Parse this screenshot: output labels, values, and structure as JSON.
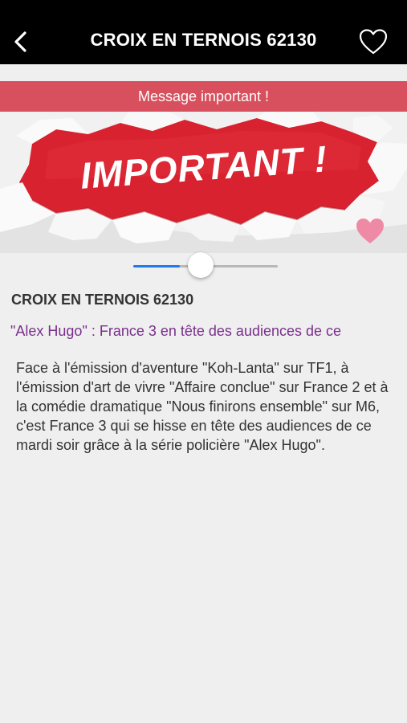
{
  "header": {
    "title": "CROIX EN TERNOIS 62130",
    "back_icon": "chevron-left-icon",
    "favorite_icon": "heart-outline-icon"
  },
  "banner": {
    "text": "Message important !",
    "color": "#d8505d"
  },
  "hero": {
    "headline": "IMPORTANT !",
    "accent_color": "#d8222f",
    "favorite_icon": "heart-filled-icon",
    "favorite_color": "#ef8aa6"
  },
  "slider": {
    "value_fraction": 0.32,
    "accent_color": "#1e7cf2"
  },
  "content": {
    "location_title": "CROIX EN TERNOIS 62130",
    "article_title": "\"Alex Hugo\" : France 3 en tête des audiences de ce",
    "article_body": "Face à l'émission d'aventure \"Koh-Lanta\" sur TF1, à l'émission d'art de vivre \"Affaire conclue\" sur France 2 et à la comédie dramatique \"Nous finirons ensemble\" sur M6, c'est France 3 qui se hisse en tête des audiences de ce mardi soir grâce à la série policière \"Alex Hugo\"."
  }
}
